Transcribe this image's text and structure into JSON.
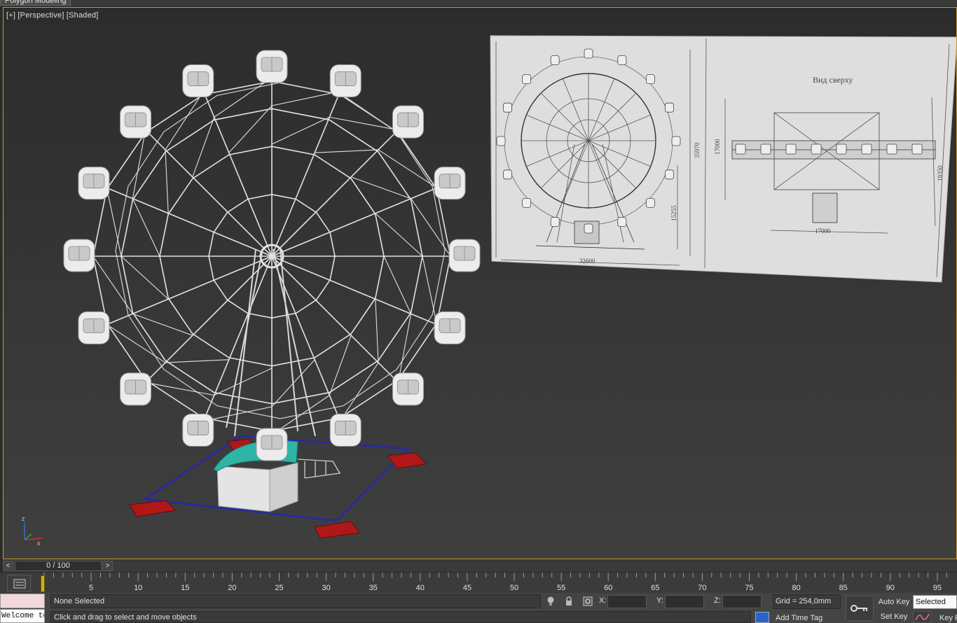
{
  "ribbon": {
    "active_tab": "Polygon Modeling"
  },
  "viewport": {
    "label_plus": "[+]",
    "label_view": "[Perspective]",
    "label_shading": "[Shaded]",
    "axis": {
      "z": "z",
      "x": "x"
    }
  },
  "reference_image": {
    "top_view_title": "Вид сверху",
    "dims": {
      "overall_width": "32600",
      "height_total": "35970",
      "height_lower": "15255",
      "plan_width": "17000",
      "plan_height_left": "17000",
      "plan_height_right": "19350"
    }
  },
  "time_slider": {
    "label": "0 / 100",
    "prev": "<",
    "next": ">"
  },
  "track_bar": {
    "ticks": [
      5,
      10,
      15,
      20,
      25,
      30,
      35,
      40,
      45,
      50,
      55,
      60,
      65,
      70,
      75,
      80,
      85,
      90,
      95
    ]
  },
  "status": {
    "maxscript_text": "Welcome to MAXScript",
    "selection": "None Selected",
    "prompt": "Click and drag to select and move objects",
    "x_label": "X:",
    "y_label": "Y:",
    "z_label": "Z:",
    "grid": "Grid = 254,0mm",
    "add_time_tag": "Add Time Tag",
    "auto_key": "Auto Key",
    "set_key": "Set Key",
    "selected_option": "Selected",
    "key_filters": "Key Filters..."
  },
  "colors": {
    "viewport_border": "#c8a02b",
    "cabin_roof": "#2fb5a5",
    "base_block": "#b01818",
    "bbox": "#2a2a9a"
  },
  "icons": [
    "lightbulb-icon",
    "lock-icon",
    "absolute-mode-icon",
    "key-icon",
    "curve-editor-icon",
    "time-tag-icon",
    "key-filter-icon"
  ]
}
